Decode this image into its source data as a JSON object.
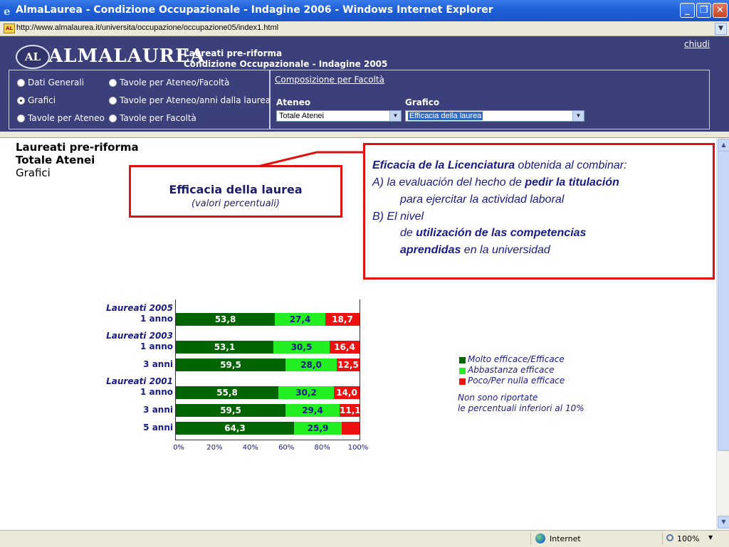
{
  "window": {
    "title": "AlmaLaurea - Condizione Occupazionale - Indagine 2006 - Windows Internet Explorer",
    "address": "http://www.almalaurea.it/universita/occupazione/occupazione05/index1.html"
  },
  "header": {
    "logo_badge": "AL",
    "logo_text": "ALMALAUREA",
    "line1": "Laureati pre-riforma",
    "line2": "Condizione Occupazionale - Indagine 2005",
    "close_link": "chiudi"
  },
  "nav": {
    "options": [
      {
        "label": "Dati Generali",
        "selected": false
      },
      {
        "label": "Tavole per Ateneo/Facoltà",
        "selected": false
      },
      {
        "label": "Grafici",
        "selected": true
      },
      {
        "label": "Tavole per Ateneo/anni dalla laurea",
        "selected": false
      },
      {
        "label": "Tavole per Ateneo",
        "selected": false
      },
      {
        "label": "Tavole per Facoltà",
        "selected": false
      }
    ],
    "facolta_link": "Composizione per Facoltà",
    "ateneo_label": "Ateneo",
    "ateneo_value": "Totale Atenei",
    "grafico_label": "Grafico",
    "grafico_value": "Efficacia della laurea"
  },
  "content": {
    "title1": "Laureati pre-riforma",
    "title2": "Totale Atenei",
    "title3": "Grafici",
    "chart_title": "Efficacia della laurea",
    "chart_subtitle": "(valori percentuali)"
  },
  "annotation": {
    "l1_b": "Eficacia de la Licenciatura",
    "l1_r": " obtenida al combinar:",
    "l2_r": "A) la evaluación del hecho de ",
    "l2_b": "pedir la titulación",
    "l3": "para ejercitar la actividad laboral",
    "l4": "B) El nivel",
    "l5_r": "de ",
    "l5_b": "utilización de las competencias",
    "l6_b": "aprendidas",
    "l6_r": " en la universidad"
  },
  "chart_data": {
    "type": "bar",
    "stacked": true,
    "orientation": "horizontal",
    "title": "Efficacia della laurea",
    "subtitle": "(valori percentuali)",
    "groups": [
      {
        "name": "Laureati 2005",
        "rows": [
          {
            "label": "1 anno",
            "values": [
              53.8,
              27.4,
              18.7
            ],
            "labels": [
              "53,8",
              "27,4",
              "18,7"
            ]
          }
        ]
      },
      {
        "name": "Laureati 2003",
        "rows": [
          {
            "label": "1 anno",
            "values": [
              53.1,
              30.5,
              16.4
            ],
            "labels": [
              "53,1",
              "30,5",
              "16,4"
            ]
          },
          {
            "label": "3 anni",
            "values": [
              59.5,
              28.0,
              12.5
            ],
            "labels": [
              "59,5",
              "28,0",
              "12,5"
            ]
          }
        ]
      },
      {
        "name": "Laureati 2001",
        "rows": [
          {
            "label": "1 anno",
            "values": [
              55.8,
              30.2,
              14.0
            ],
            "labels": [
              "55,8",
              "30,2",
              "14,0"
            ]
          },
          {
            "label": "3 anni",
            "values": [
              59.5,
              29.4,
              11.1
            ],
            "labels": [
              "59,5",
              "29,4",
              "11,1"
            ]
          },
          {
            "label": "5 anni",
            "values": [
              64.3,
              25.9,
              9.8
            ],
            "labels": [
              "64,3",
              "25,9",
              ""
            ]
          }
        ]
      }
    ],
    "series": [
      {
        "name": "Molto efficace/Efficace",
        "color": "#006400"
      },
      {
        "name": "Abbastanza efficace",
        "color": "#22ee22"
      },
      {
        "name": "Poco/Per nulla efficace",
        "color": "#ee1111"
      }
    ],
    "xticks": [
      "0%",
      "20%",
      "40%",
      "60%",
      "80%",
      "100%"
    ],
    "xlim": [
      0,
      100
    ],
    "note1": "Non sono riportate",
    "note2": "le percentuali inferiori al 10%",
    "legend_position": "right"
  },
  "status": {
    "zone": "Internet",
    "zoom": "100%"
  }
}
